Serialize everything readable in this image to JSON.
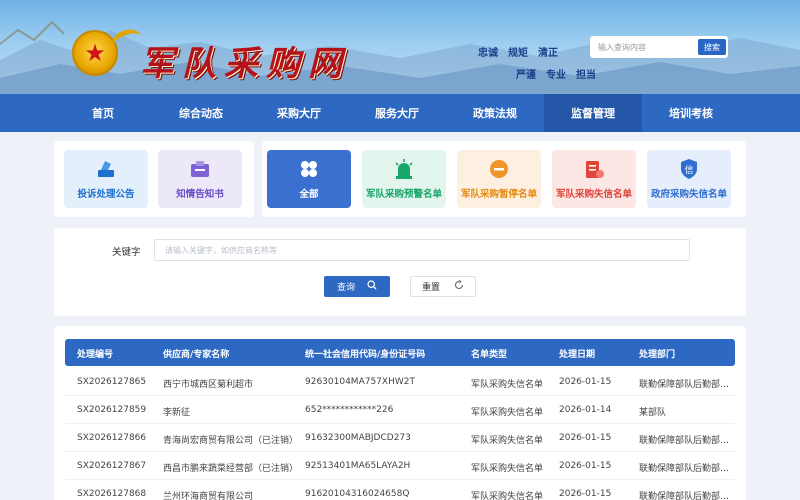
{
  "header": {
    "site_title": "军队采购网",
    "slogans_row1": [
      "忠诚",
      "规矩",
      "清正"
    ],
    "slogans_row2": [
      "严谨",
      "专业",
      "担当"
    ],
    "search_placeholder": "输入查询内容",
    "search_button": "搜索"
  },
  "nav": {
    "items": [
      "首页",
      "综合动态",
      "采购大厅",
      "服务大厅",
      "政策法规",
      "监督管理",
      "培训考核"
    ],
    "active_index": 5
  },
  "categories_left": [
    {
      "label": "投诉处理公告",
      "icon": "complaint-icon",
      "bg": "#e3f0fb",
      "color": "#1e6fd0"
    },
    {
      "label": "知情告知书",
      "icon": "notice-icon",
      "bg": "#ece8f8",
      "color": "#6b4fc8"
    }
  ],
  "categories_right": [
    {
      "label": "全部",
      "icon": "grid-icon",
      "bg": "#3b6fd0",
      "color": "#ffffff"
    },
    {
      "label": "军队采购预警名单",
      "icon": "alarm-icon",
      "bg": "#e3f6ee",
      "color": "#18a66a"
    },
    {
      "label": "军队采购暂停名单",
      "icon": "pause-icon",
      "bg": "#fdf0e0",
      "color": "#e58a12"
    },
    {
      "label": "军队采购失信名单",
      "icon": "dishonest-icon",
      "bg": "#fde7e4",
      "color": "#e0453a"
    },
    {
      "label": "政府采购失信名单",
      "icon": "credit-icon",
      "bg": "#e6eefb",
      "color": "#2f6fd0"
    }
  ],
  "filter": {
    "keyword_label": "关键字",
    "keyword_placeholder": "请输入关键字，如供应商名称等",
    "query_button": "查询",
    "reset_button": "重置"
  },
  "table": {
    "columns": [
      "处理编号",
      "供应商/专家名称",
      "统一社会信用代码/身份证号码",
      "名单类型",
      "处理日期",
      "处理部门"
    ],
    "rows": [
      [
        "SX2026127865",
        "西宁市城西区菊利超市",
        "92630104MA757XHW2T",
        "军队采购失信名单",
        "2026-01-15",
        "联勤保障部队后勤部…"
      ],
      [
        "SX2026127859",
        "李新征",
        "652************226",
        "军队采购失信名单",
        "2026-01-14",
        "某部队"
      ],
      [
        "SX2026127866",
        "青海尚宏商贸有限公司（已注销）",
        "91632300MABJDCD273",
        "军队采购失信名单",
        "2026-01-15",
        "联勤保障部队后勤部…"
      ],
      [
        "SX2026127867",
        "西昌市鹏来蔬菜经营部（已注销）",
        "92513401MA65LAYA2H",
        "军队采购失信名单",
        "2026-01-15",
        "联勤保障部队后勤部…"
      ],
      [
        "SX2026127868",
        "兰州环海商贸有限公司",
        "91620104316024658Q",
        "军队采购失信名单",
        "2026-01-15",
        "联勤保障部队后勤部…"
      ]
    ]
  }
}
